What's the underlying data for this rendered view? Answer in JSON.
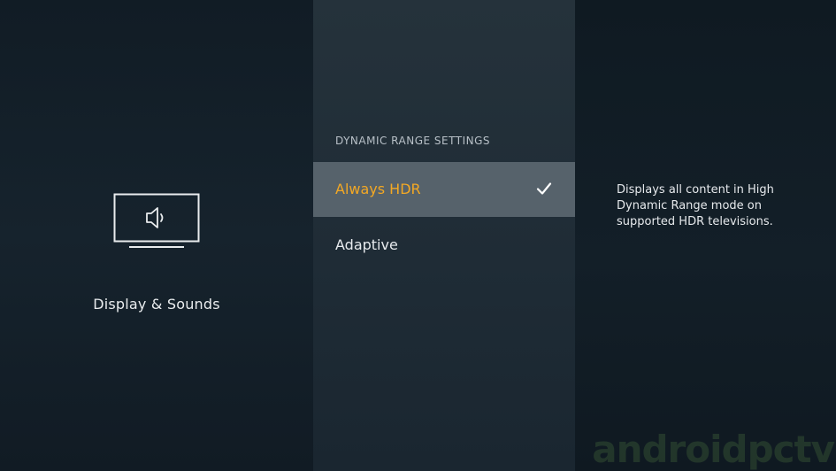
{
  "left_panel": {
    "title": "Display & Sounds",
    "icon": "tv-speaker-icon"
  },
  "settings": {
    "header": "DYNAMIC RANGE SETTINGS",
    "options": [
      {
        "label": "Always HDR",
        "selected": true
      },
      {
        "label": "Adaptive",
        "selected": false
      }
    ]
  },
  "description": {
    "text": "Displays all content in High Dynamic Range mode on supported HDR televisions."
  },
  "watermark": {
    "text": "androidpctv"
  },
  "colors": {
    "accent": "#f3a824",
    "selected_row": "#56626b",
    "background": "#0f1a23"
  }
}
